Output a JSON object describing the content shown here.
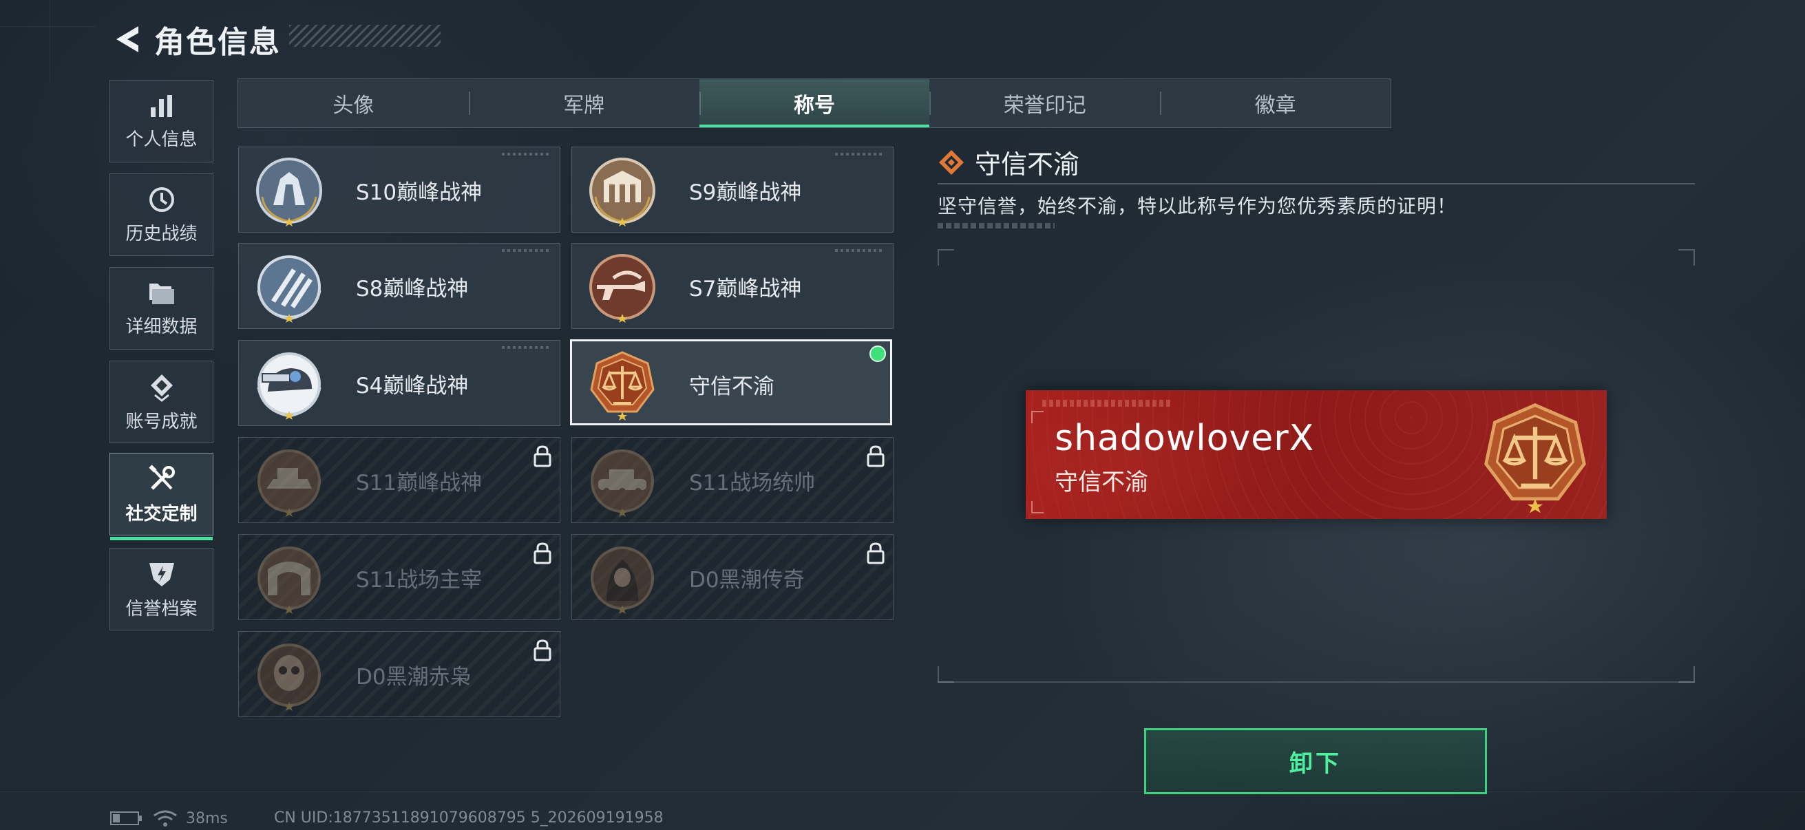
{
  "header": {
    "title": "角色信息"
  },
  "nav": {
    "items": [
      {
        "label": "个人信息",
        "icon": "bar-chart-icon",
        "active": false
      },
      {
        "label": "历史战绩",
        "icon": "history-clock-icon",
        "active": false
      },
      {
        "label": "详细数据",
        "icon": "folder-icon",
        "active": false
      },
      {
        "label": "账号成就",
        "icon": "achievement-icon",
        "active": false
      },
      {
        "label": "社交定制",
        "icon": "wrench-screwdriver-icon",
        "active": true
      },
      {
        "label": "信誉档案",
        "icon": "credit-shield-icon",
        "active": false
      }
    ]
  },
  "tabs": [
    {
      "label": "头像",
      "active": false
    },
    {
      "label": "军牌",
      "active": false
    },
    {
      "label": "称号",
      "active": true
    },
    {
      "label": "荣誉印记",
      "active": false
    },
    {
      "label": "徽章",
      "active": false
    }
  ],
  "titles": [
    {
      "label": "S10巅峰战神",
      "locked": false,
      "selected": false
    },
    {
      "label": "S9巅峰战神",
      "locked": false,
      "selected": false
    },
    {
      "label": "S8巅峰战神",
      "locked": false,
      "selected": false
    },
    {
      "label": "S7巅峰战神",
      "locked": false,
      "selected": false
    },
    {
      "label": "S4巅峰战神",
      "locked": false,
      "selected": false
    },
    {
      "label": "守信不渝",
      "locked": false,
      "selected": true,
      "equipped": true
    },
    {
      "label": "S11巅峰战神",
      "locked": true
    },
    {
      "label": "S11战场统帅",
      "locked": true
    },
    {
      "label": "S11战场主宰",
      "locked": true
    },
    {
      "label": "D0黑潮传奇",
      "locked": true
    },
    {
      "label": "D0黑潮赤枭",
      "locked": true
    }
  ],
  "detail": {
    "title": "守信不渝",
    "description": "坚守信誉，始终不渝，特以此称号作为您优秀素质的证明！"
  },
  "nameplate": {
    "player_name": "shadowloverX",
    "title": "守信不渝"
  },
  "unequip_button": {
    "label": "卸下"
  },
  "status": {
    "ping": "38ms",
    "uid": "CN UID:18773511891079608795 5_202609191958"
  },
  "colors": {
    "accent_green": "#4fe0a0",
    "equipped_dot": "#3fe07a",
    "nameplate_red": "#a8221f",
    "emblem_bronze": "#b56a2c"
  }
}
